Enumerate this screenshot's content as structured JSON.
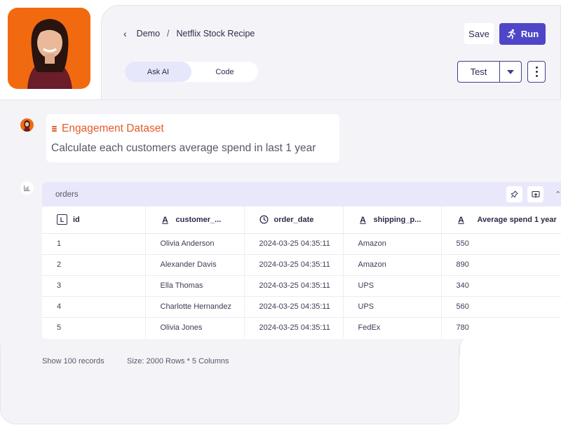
{
  "header": {
    "breadcrumb": {
      "parent": "Demo",
      "separator": "/",
      "current": "Netflix Stock Recipe"
    },
    "toggle": {
      "options": [
        "Ask AI",
        "Code"
      ],
      "active": "Ask AI"
    },
    "save_label": "Save",
    "run_label": "Run",
    "test_label": "Test"
  },
  "message": {
    "dataset_label": "Engagement Dataset",
    "question": "Calculate each customers average spend in last 1 year"
  },
  "table": {
    "name": "orders",
    "columns": [
      {
        "label": "id",
        "icon": "integer-icon"
      },
      {
        "label": "customer_...",
        "icon": "text-type-icon"
      },
      {
        "label": "order_date",
        "icon": "clock-icon"
      },
      {
        "label": "shipping_p...",
        "icon": "text-type-icon"
      },
      {
        "label": "Average spend 1 year",
        "icon": "text-type-icon"
      }
    ],
    "rows": [
      [
        "1",
        "Olivia Anderson",
        "2024-03-25 04:35:11",
        "Amazon",
        "550"
      ],
      [
        "2",
        "Alexander Davis",
        "2024-03-25 04:35:11",
        "Amazon",
        "890"
      ],
      [
        "3",
        "Ella Thomas",
        "2024-03-25 04:35:11",
        "UPS",
        "340"
      ],
      [
        "4",
        "Charlotte Hernandez",
        "2024-03-25 04:35:11",
        "UPS",
        "560"
      ],
      [
        "5",
        "Olivia Jones",
        "2024-03-25 04:35:11",
        "FedEx",
        "780"
      ]
    ]
  },
  "footer": {
    "records": "Show 100 records",
    "size": "Size: 2000 Rows * 5 Columns"
  },
  "colors": {
    "accent": "#4f46c7",
    "dataset": "#e45a2a",
    "avatar_bg": "#f26a0f",
    "panel_head": "#e9e8fb"
  }
}
